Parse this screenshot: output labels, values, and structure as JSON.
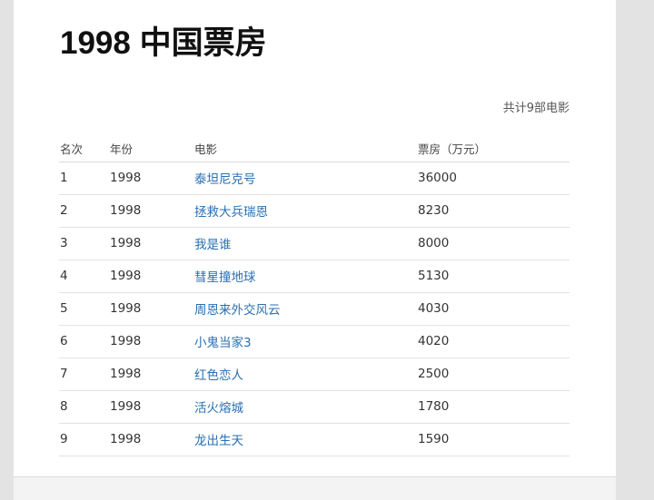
{
  "title": "1998 中国票房",
  "summary": "共计9部电影",
  "table": {
    "headers": [
      "名次",
      "年份",
      "电影",
      "票房（万元）"
    ],
    "rows": [
      {
        "rank": "1",
        "year": "1998",
        "movie": "泰坦尼克号",
        "box_office": "36000"
      },
      {
        "rank": "2",
        "year": "1998",
        "movie": "拯救大兵瑞恩",
        "box_office": "8230"
      },
      {
        "rank": "3",
        "year": "1998",
        "movie": "我是谁",
        "box_office": "8000"
      },
      {
        "rank": "4",
        "year": "1998",
        "movie": "彗星撞地球",
        "box_office": "5130"
      },
      {
        "rank": "5",
        "year": "1998",
        "movie": "周恩来外交风云",
        "box_office": "4030"
      },
      {
        "rank": "6",
        "year": "1998",
        "movie": "小鬼当家3",
        "box_office": "4020"
      },
      {
        "rank": "7",
        "year": "1998",
        "movie": "红色恋人",
        "box_office": "2500"
      },
      {
        "rank": "8",
        "year": "1998",
        "movie": "活火熔城",
        "box_office": "1780"
      },
      {
        "rank": "9",
        "year": "1998",
        "movie": "龙出生天",
        "box_office": "1590"
      }
    ]
  },
  "colors": {
    "link": "#2a6fb0",
    "title": "#111111",
    "background": "#e3e3e3",
    "card": "#ffffff"
  }
}
